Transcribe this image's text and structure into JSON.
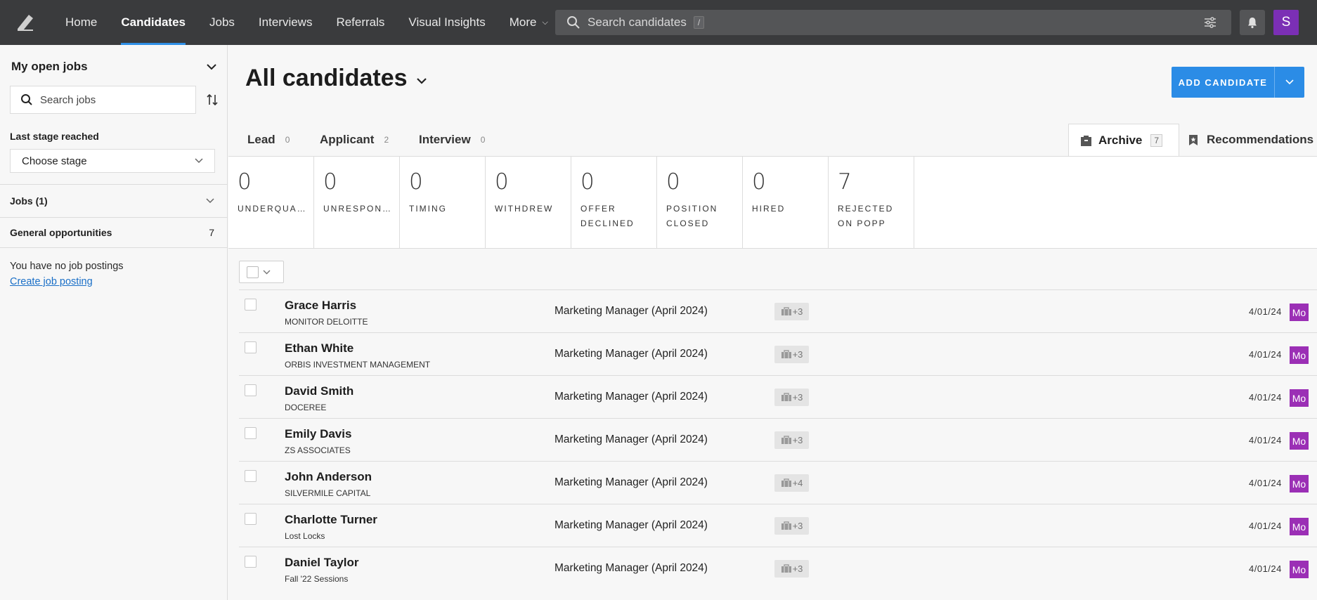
{
  "nav": {
    "items": [
      {
        "label": "Home",
        "active": false
      },
      {
        "label": "Candidates",
        "active": true
      },
      {
        "label": "Jobs",
        "active": false
      },
      {
        "label": "Interviews",
        "active": false
      },
      {
        "label": "Referrals",
        "active": false
      },
      {
        "label": "Visual Insights",
        "active": false
      },
      {
        "label": "More",
        "active": false
      }
    ],
    "search_placeholder": "Search candidates",
    "search_shortcut": "/",
    "user_initial": "S"
  },
  "sidebar": {
    "header": "My open jobs",
    "search_placeholder": "Search jobs",
    "last_stage_label": "Last stage reached",
    "stage_select": "Choose stage",
    "jobs_label": "Jobs (1)",
    "general_label": "General opportunities",
    "general_count": "7",
    "no_postings": "You have no job postings",
    "create_link": "Create job posting"
  },
  "main": {
    "title": "All candidates",
    "add_button": "ADD CANDIDATE",
    "stage_tabs": [
      {
        "label": "Lead",
        "count": "0"
      },
      {
        "label": "Applicant",
        "count": "2"
      },
      {
        "label": "Interview",
        "count": "0"
      }
    ],
    "archive_tab": {
      "label": "Archive",
      "count": "7"
    },
    "recommendations_tab": "Recommendations",
    "archive_reasons": [
      {
        "count": "0",
        "label": "UNDERQUA…"
      },
      {
        "count": "0",
        "label": "UNRESPON…"
      },
      {
        "count": "0",
        "label": "TIMING"
      },
      {
        "count": "0",
        "label": "WITHDREW"
      },
      {
        "count": "0",
        "label": "OFFER\nDECLINED"
      },
      {
        "count": "0",
        "label": "POSITION\nCLOSED"
      },
      {
        "count": "0",
        "label": "HIRED"
      },
      {
        "count": "7",
        "label": "REJECTED\nON POPP"
      }
    ],
    "candidates": [
      {
        "name": "Grace Harris",
        "company": "MONITOR DELOITTE",
        "job": "Marketing Manager (April 2024)",
        "tag": "+3",
        "date": "4/01/24",
        "owner": "Mo"
      },
      {
        "name": "Ethan White",
        "company": "ORBIS INVESTMENT MANAGEMENT",
        "job": "Marketing Manager (April 2024)",
        "tag": "+3",
        "date": "4/01/24",
        "owner": "Mo"
      },
      {
        "name": "David Smith",
        "company": "DOCEREE",
        "job": "Marketing Manager (April 2024)",
        "tag": "+3",
        "date": "4/01/24",
        "owner": "Mo"
      },
      {
        "name": "Emily Davis",
        "company": "ZS ASSOCIATES",
        "job": "Marketing Manager (April 2024)",
        "tag": "+3",
        "date": "4/01/24",
        "owner": "Mo"
      },
      {
        "name": "John Anderson",
        "company": "SILVERMILE CAPITAL",
        "job": "Marketing Manager (April 2024)",
        "tag": "+4",
        "date": "4/01/24",
        "owner": "Mo"
      },
      {
        "name": "Charlotte Turner",
        "company": "Lost Locks",
        "job": "Marketing Manager (April 2024)",
        "tag": "+3",
        "date": "4/01/24",
        "owner": "Mo"
      },
      {
        "name": "Daniel Taylor",
        "company": "Fall '22 Sessions",
        "job": "Marketing Manager (April 2024)",
        "tag": "+3",
        "date": "4/01/24",
        "owner": "Mo"
      }
    ]
  },
  "colors": {
    "topbar": "#3a3b3d",
    "accent": "#2b8ce6",
    "owner_badge": "#9b2fb5",
    "user_avatar": "#7b2fb5",
    "link": "#1a6fc7"
  }
}
